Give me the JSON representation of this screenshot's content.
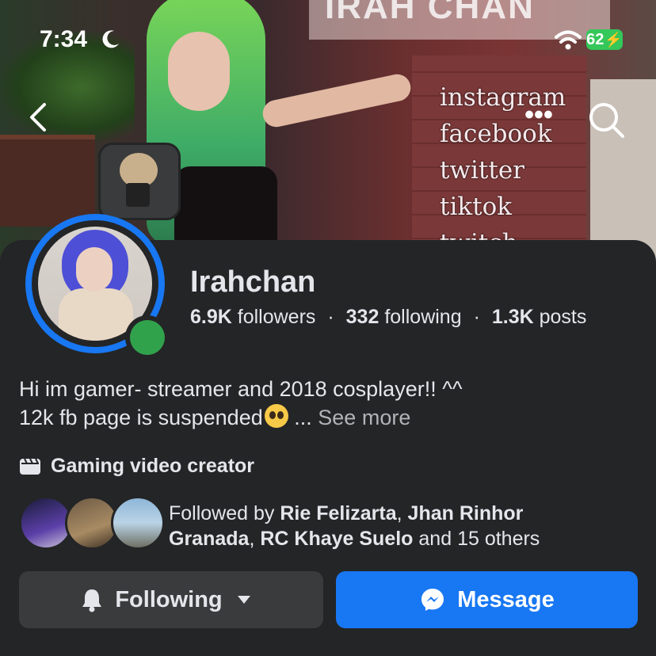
{
  "status_bar": {
    "time": "7:34",
    "battery": "62"
  },
  "cover": {
    "banner_text": "IRAH CHAN",
    "social_links": [
      "instagram",
      "facebook",
      "twitter",
      "tiktok",
      "twitch"
    ]
  },
  "profile": {
    "name": "Irahchan",
    "followers_count": "6.9K",
    "followers_label": "followers",
    "following_count": "332",
    "following_label": "following",
    "posts_count": "1.3K",
    "posts_label": "posts",
    "separator": "·",
    "bio_line1": "Hi im gamer- streamer and 2018 cosplayer!! ^^",
    "bio_line2": "12k fb page is suspended",
    "bio_ellipsis": "...",
    "see_more": "See more",
    "category": "Gaming video creator"
  },
  "mutual": {
    "prefix": "Followed by",
    "name1": "Rie Felizarta",
    "comma": ",",
    "name2a": "Jhan Rinhor",
    "name2b": "Granada",
    "name3": "RC Khaye Suelo",
    "suffix": "and 15 others"
  },
  "actions": {
    "following_label": "Following",
    "message_label": "Message"
  },
  "colors": {
    "accent": "#1877f2",
    "online": "#31a24c",
    "background": "#242526"
  }
}
